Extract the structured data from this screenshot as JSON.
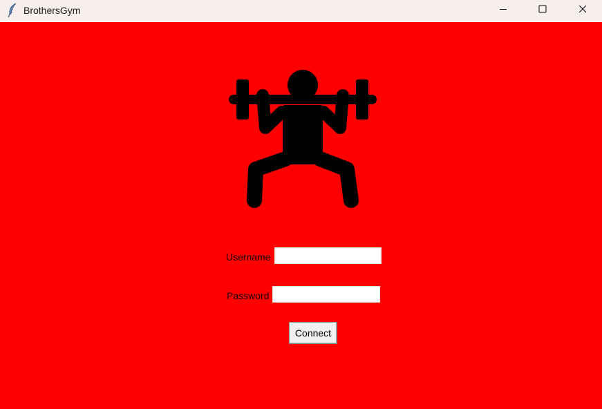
{
  "window": {
    "title": "BrothersGym",
    "app_icon": "feather-icon",
    "controls": [
      "minimize-icon",
      "maximize-icon",
      "close-icon"
    ]
  },
  "client": {
    "background_color": "#ff0000",
    "logo_icon": "weightlifter-icon"
  },
  "form": {
    "username_label": "Username",
    "username_value": "",
    "password_label": "Password",
    "password_value": "",
    "connect_label": "Connect"
  }
}
